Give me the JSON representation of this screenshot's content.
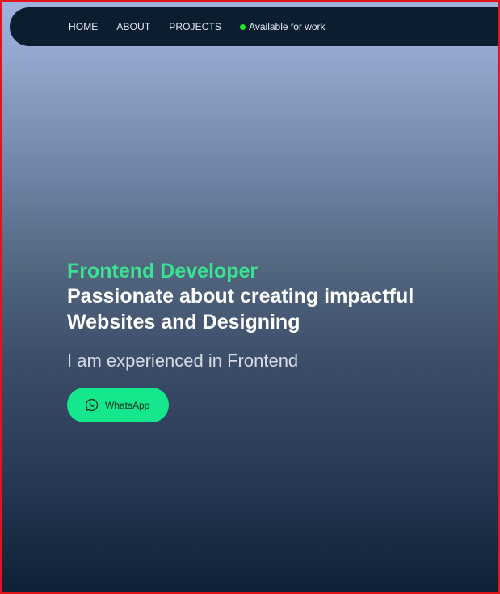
{
  "nav": {
    "items": [
      {
        "label": "HOME"
      },
      {
        "label": "ABOUT"
      },
      {
        "label": "PROJECTS"
      }
    ],
    "status": {
      "label": "Available for work",
      "color": "#22e62a"
    }
  },
  "hero": {
    "role": "Frontend Developer",
    "headline": "Passionate about creating impactful Websites and Designing",
    "subtitle": "I am experienced in Frontend",
    "cta": {
      "label": "WhatsApp",
      "icon": "whatsapp-icon"
    }
  },
  "colors": {
    "navbar_bg": "#0a1e30",
    "accent_green": "#39e391",
    "button_bg": "#15e88c"
  }
}
